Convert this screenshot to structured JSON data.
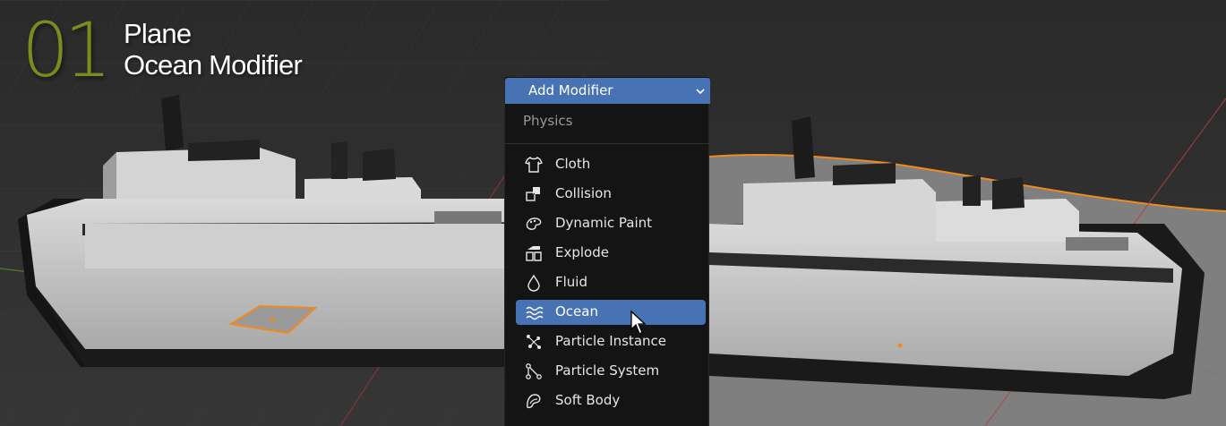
{
  "title": {
    "number": "01",
    "line1": "Plane",
    "line2": "Ocean Modifier"
  },
  "menu": {
    "header": "Add Modifier",
    "section": "Physics",
    "selected_index": 5,
    "items": [
      {
        "label": "Cloth",
        "icon": "cloth-icon"
      },
      {
        "label": "Collision",
        "icon": "collision-icon"
      },
      {
        "label": "Dynamic Paint",
        "icon": "dynamic-paint-icon"
      },
      {
        "label": "Explode",
        "icon": "explode-icon"
      },
      {
        "label": "Fluid",
        "icon": "fluid-icon"
      },
      {
        "label": "Ocean",
        "icon": "ocean-icon"
      },
      {
        "label": "Particle Instance",
        "icon": "particle-instance-icon"
      },
      {
        "label": "Particle System",
        "icon": "particle-system-icon"
      },
      {
        "label": "Soft Body",
        "icon": "soft-body-icon"
      }
    ]
  },
  "colors": {
    "accent": "#4772b3",
    "title_number": "#7a8c1d",
    "selection_outline": "#f08a1f",
    "x_axis": "#a23434",
    "y_axis": "#5d8a2a"
  }
}
